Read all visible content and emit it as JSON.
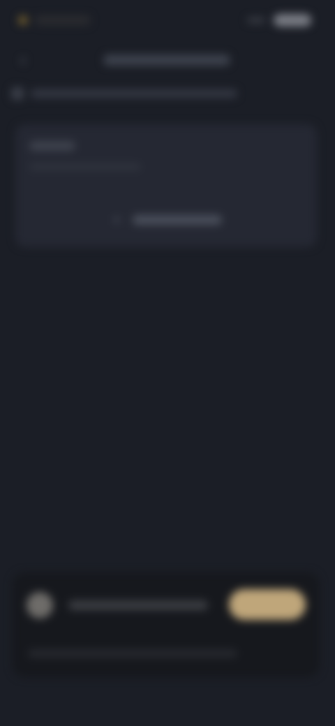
{
  "status_bar": {
    "time": "",
    "accent_color": "#6d5a2d"
  },
  "header": {
    "title": "",
    "back_icon": "chevron-left-icon"
  },
  "subtitle": {
    "text": ""
  },
  "card": {
    "heading": "",
    "body": "",
    "action_label": "",
    "action_icon": "plus-icon"
  },
  "composer": {
    "placeholder": "",
    "cta_label": "",
    "cta_color": "#bfa67a",
    "footer_text": ""
  },
  "colors": {
    "background": "#1b1e26",
    "card": "#252833",
    "composer": "#16181d"
  }
}
